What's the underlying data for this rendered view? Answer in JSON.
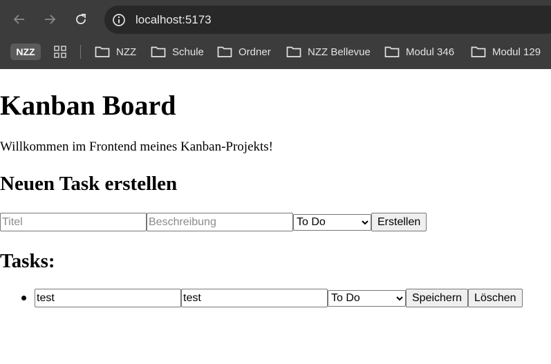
{
  "browser": {
    "url": "localhost:5173",
    "bookmarks": {
      "nzz_badge": "NZZ",
      "folders": [
        "NZZ",
        "Schule",
        "Ordner",
        "NZZ Bellevue",
        "Modul 346",
        "Modul 129"
      ]
    }
  },
  "page": {
    "title": "Kanban Board",
    "welcome": "Willkommen im Frontend meines Kanban-Projekts!",
    "create_heading": "Neuen Task erstellen",
    "form": {
      "title_placeholder": "Titel",
      "description_placeholder": "Beschreibung",
      "status_selected": "To Do",
      "submit_label": "Erstellen"
    },
    "tasks_heading": "Tasks:",
    "tasks": [
      {
        "title": "test",
        "description": "test",
        "status": "To Do",
        "save_label": "Speichern",
        "delete_label": "Löschen"
      }
    ]
  },
  "colors": {
    "chrome_bg": "#3c3c3c",
    "omnibox_bg": "#282828",
    "page_bg": "#ffffff"
  }
}
